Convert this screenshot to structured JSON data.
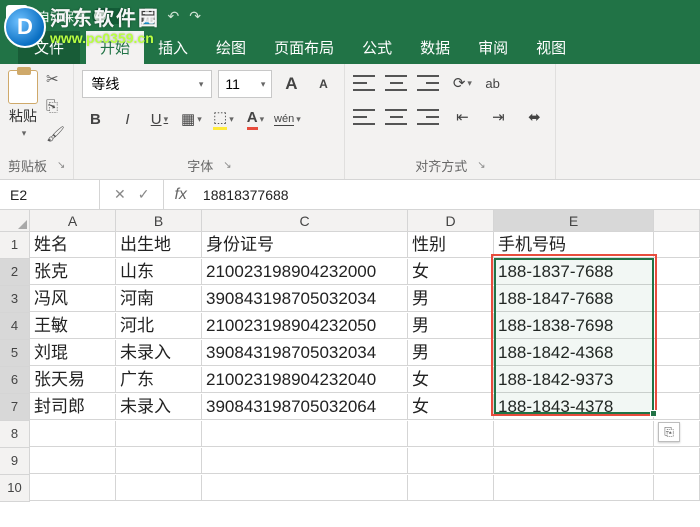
{
  "titlebar": {
    "autosave_label": "自动保存",
    "autosave_on": false
  },
  "watermark": {
    "site_cn": "河东软件园",
    "site_url": "www.pc0359.cn"
  },
  "tabs": {
    "file": "文件",
    "home": "开始",
    "insert": "插入",
    "draw": "绘图",
    "layout": "页面布局",
    "formulas": "公式",
    "data": "数据",
    "review": "审阅",
    "view": "视图"
  },
  "ribbon": {
    "paste": "粘贴",
    "clipboard": "剪贴板",
    "font_name": "等线",
    "font_size": "11",
    "font_group": "字体",
    "align_group": "对齐方式",
    "bold": "B",
    "italic": "I",
    "underline": "U",
    "wen": "wén",
    "ab": "ab"
  },
  "formula_bar": {
    "name_box": "E2",
    "fx": "fx",
    "value": "18818377688"
  },
  "columns": [
    "A",
    "B",
    "C",
    "D",
    "E"
  ],
  "headers": {
    "A": "姓名",
    "B": "出生地",
    "C": "身份证号",
    "D": "性别",
    "E": "手机号码"
  },
  "rows": [
    {
      "A": "张克",
      "B": "山东",
      "C": "210023198904232000",
      "D": "女",
      "E": "188-1837-7688"
    },
    {
      "A": "冯风",
      "B": "河南",
      "C": "390843198705032034",
      "D": "男",
      "E": "188-1847-7688"
    },
    {
      "A": "王敏",
      "B": "河北",
      "C": "210023198904232050",
      "D": "男",
      "E": "188-1838-7698"
    },
    {
      "A": "刘琨",
      "B": "未录入",
      "C": "390843198705032034",
      "D": "男",
      "E": "188-1842-4368"
    },
    {
      "A": "张天易",
      "B": "广东",
      "C": "210023198904232040",
      "D": "女",
      "E": "188-1842-9373"
    },
    {
      "A": "封司郎",
      "B": "未录入",
      "C": "390843198705032064",
      "D": "女",
      "E": "188-1843-4378"
    }
  ],
  "selection": {
    "range": "E2:E7",
    "outline": "red"
  }
}
